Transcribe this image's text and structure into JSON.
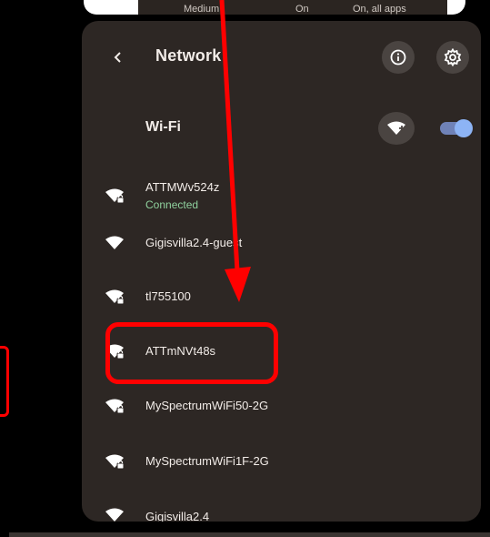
{
  "top_strip": {
    "col1": "Medium",
    "col2": "On",
    "col3": "On, all apps"
  },
  "header": {
    "back_icon": "chevron-left-icon",
    "title": "Network",
    "info_icon": "info-icon",
    "settings_icon": "gear-icon"
  },
  "wifi": {
    "label": "Wi-Fi",
    "add_icon": "wifi-add-icon",
    "toggle_on": true
  },
  "networks": [
    {
      "name": "ATTMWv524z",
      "status": "Connected",
      "secured": true
    },
    {
      "name": "Gigisvilla2.4-guest",
      "status": "",
      "secured": false
    },
    {
      "name": "tl755100",
      "status": "",
      "secured": true
    },
    {
      "name": "ATTmNVt48s",
      "status": "",
      "secured": true
    },
    {
      "name": "MySpectrumWiFi50-2G",
      "status": "",
      "secured": true
    },
    {
      "name": "MySpectrumWiFi1F-2G",
      "status": "",
      "secured": true
    },
    {
      "name": "Gigisvilla2.4",
      "status": "",
      "secured": false
    }
  ],
  "colors": {
    "panel_bg": "#2d2724",
    "connected_text": "#8fd19e",
    "toggle_track": "#6f82b7",
    "annotation_red": "#ff0000"
  }
}
